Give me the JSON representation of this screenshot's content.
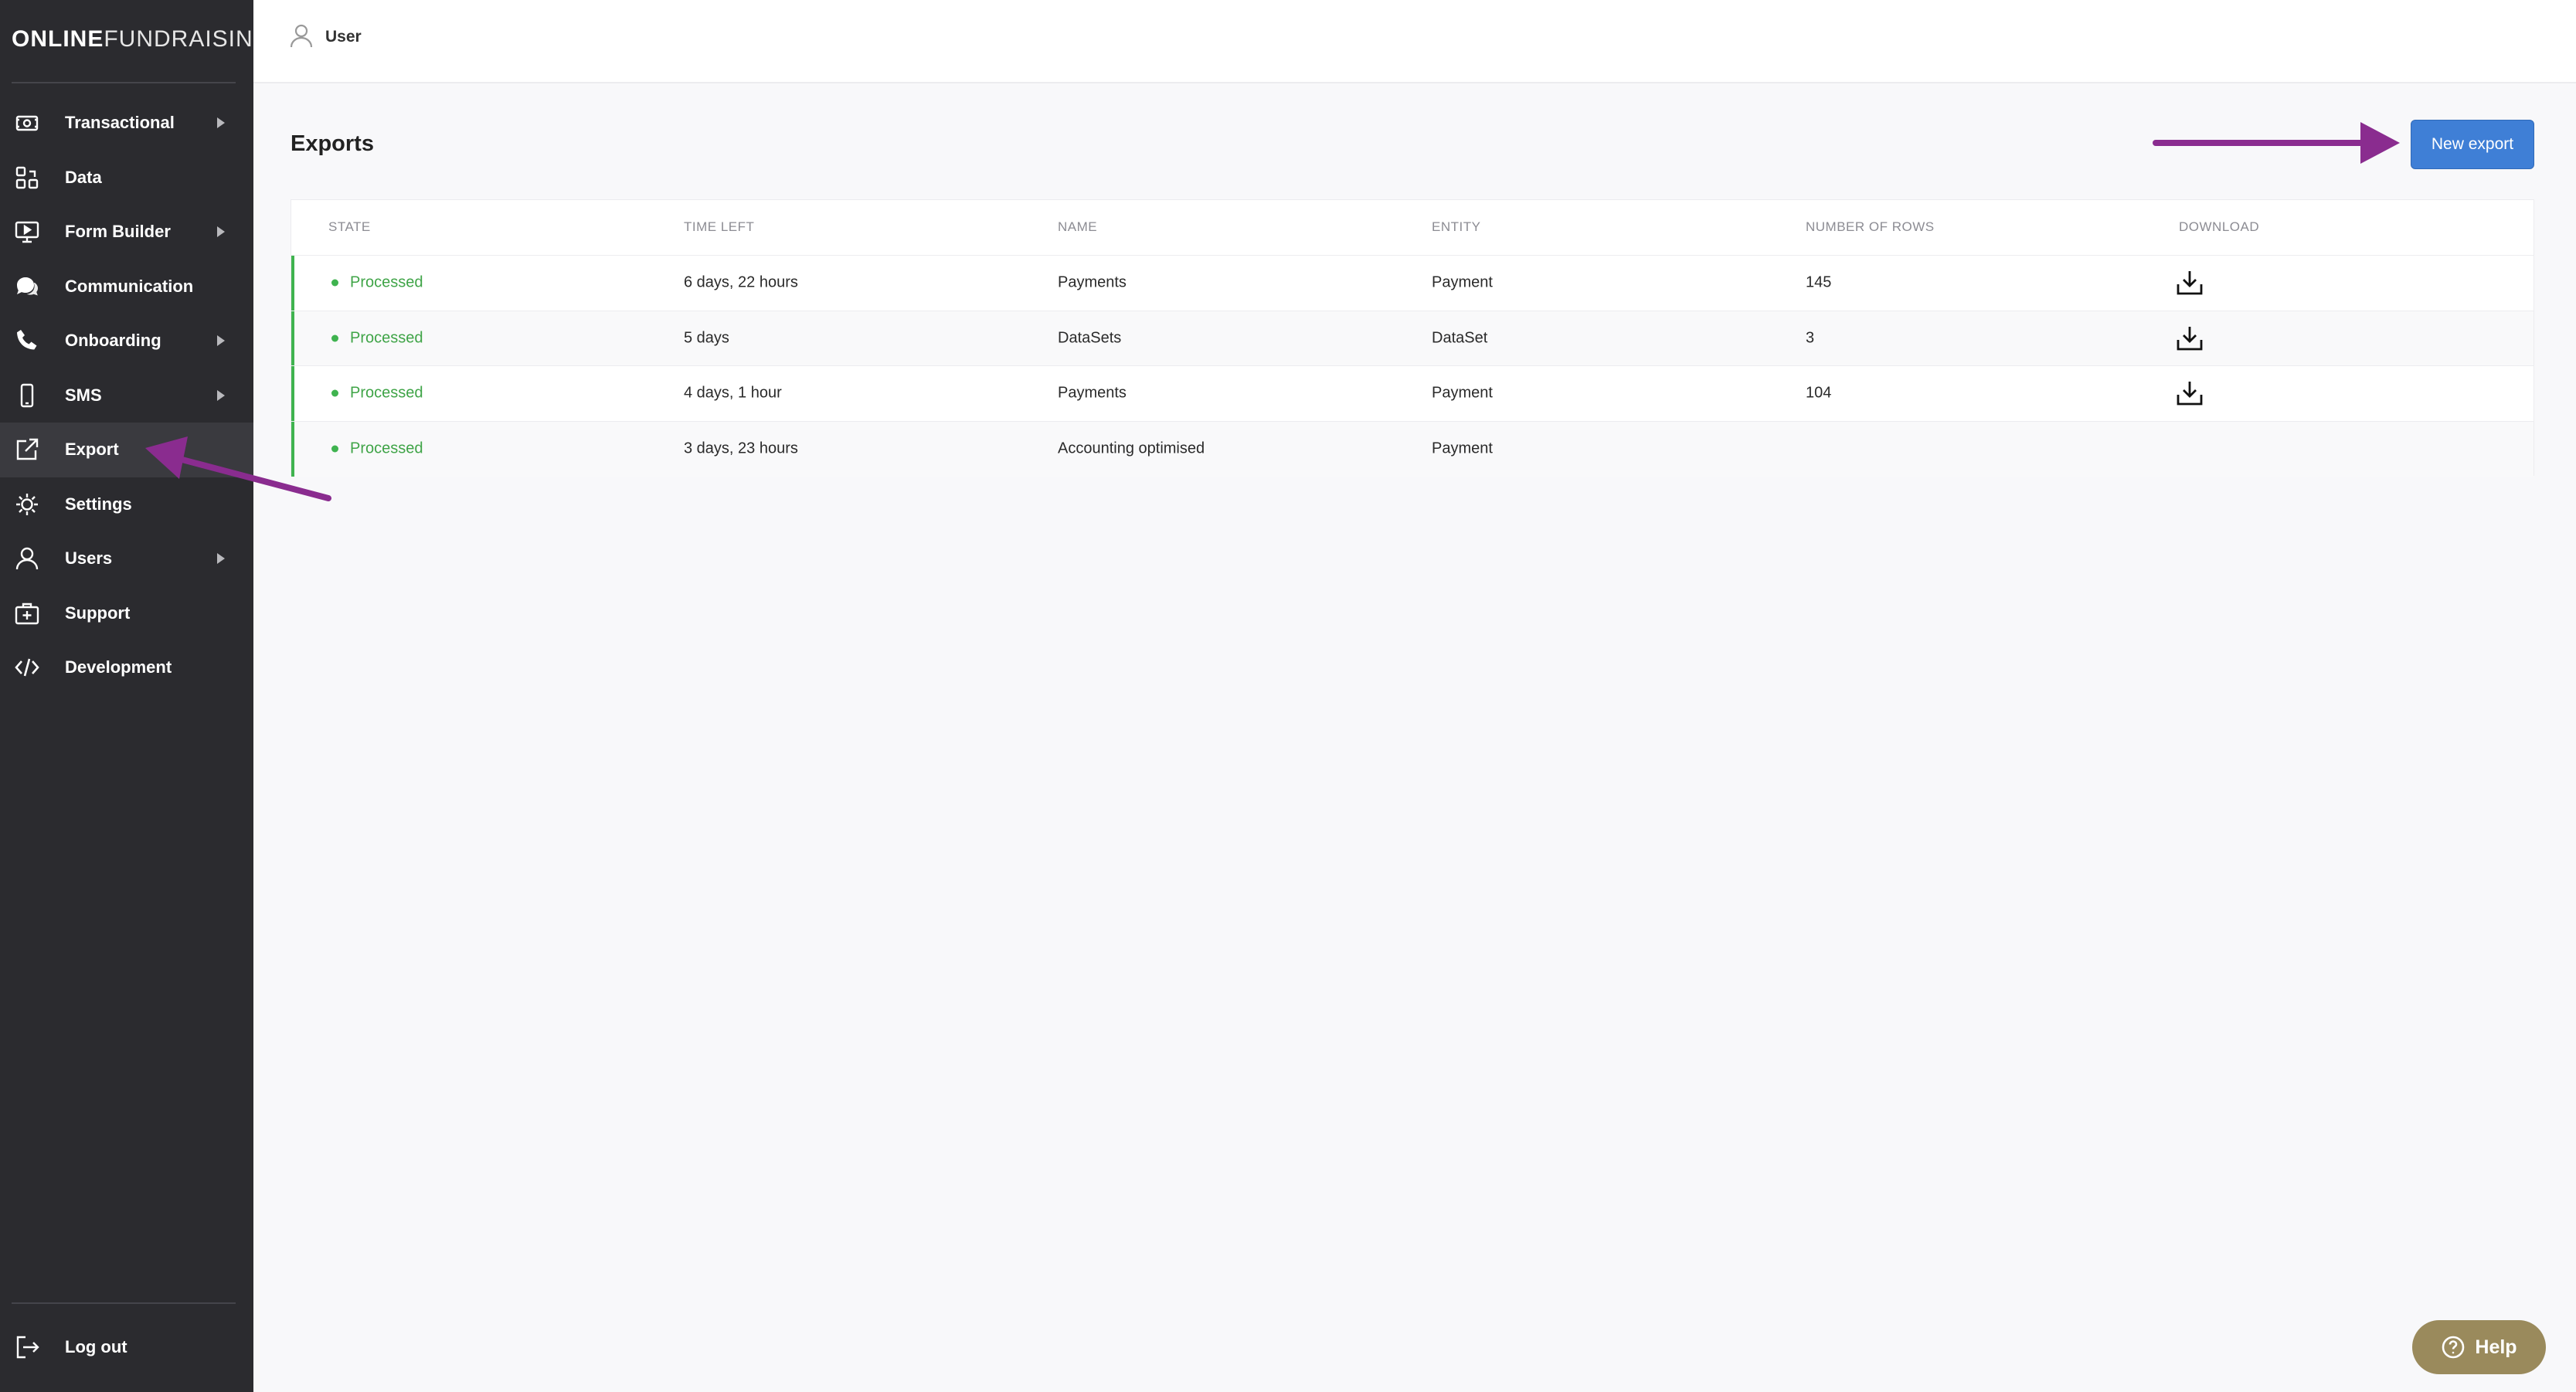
{
  "brand": {
    "bold": "ONLINE",
    "light": "FUNDRAISING"
  },
  "header": {
    "user_label": "User"
  },
  "sidebar": {
    "items": [
      {
        "label": "Transactional",
        "icon": "money-icon",
        "has_submenu": true
      },
      {
        "label": "Data",
        "icon": "data-icon",
        "has_submenu": false
      },
      {
        "label": "Form Builder",
        "icon": "monitor-icon",
        "has_submenu": true
      },
      {
        "label": "Communication",
        "icon": "chat-icon",
        "has_submenu": false
      },
      {
        "label": "Onboarding",
        "icon": "phone-icon",
        "has_submenu": true
      },
      {
        "label": "SMS",
        "icon": "mobile-icon",
        "has_submenu": true
      },
      {
        "label": "Export",
        "icon": "export-icon",
        "has_submenu": false,
        "active": true
      },
      {
        "label": "Settings",
        "icon": "gear-icon",
        "has_submenu": false
      },
      {
        "label": "Users",
        "icon": "user-icon",
        "has_submenu": true
      },
      {
        "label": "Support",
        "icon": "medkit-icon",
        "has_submenu": false
      },
      {
        "label": "Development",
        "icon": "code-icon",
        "has_submenu": false
      }
    ],
    "logout_label": "Log out"
  },
  "main": {
    "title": "Exports",
    "new_export_label": "New export",
    "table": {
      "columns": [
        "STATE",
        "TIME LEFT",
        "NAME",
        "ENTITY",
        "NUMBER OF ROWS",
        "DOWNLOAD"
      ],
      "rows": [
        {
          "state": "Processed",
          "time_left": "6 days, 22 hours",
          "name": "Payments",
          "entity": "Payment",
          "rows": "145",
          "download": true
        },
        {
          "state": "Processed",
          "time_left": "5 days",
          "name": "DataSets",
          "entity": "DataSet",
          "rows": "3",
          "download": true
        },
        {
          "state": "Processed",
          "time_left": "4 days, 1 hour",
          "name": "Payments",
          "entity": "Payment",
          "rows": "104",
          "download": true
        },
        {
          "state": "Processed",
          "time_left": "3 days, 23 hours",
          "name": "Accounting optimised",
          "entity": "Payment",
          "rows": "",
          "download": false
        }
      ]
    }
  },
  "help": {
    "label": "Help"
  },
  "colors": {
    "sidebar_bg": "#2b2b2f",
    "accent_blue": "#3f7fd6",
    "status_green": "#3fb34f",
    "annotation_purple": "#8a2c8f",
    "help_bg": "#9a8a5c"
  }
}
